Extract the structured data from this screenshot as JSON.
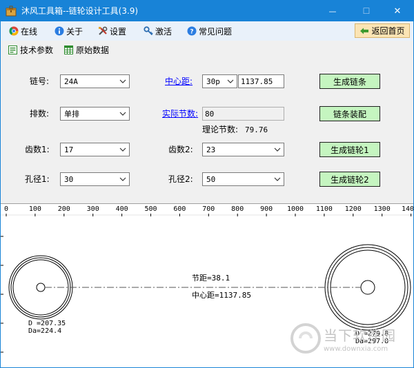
{
  "window": {
    "title": "沐风工具箱--链轮设计工具(3.9)",
    "minimize_glyph": "—",
    "maximize_glyph": "☐",
    "close_glyph": "✕"
  },
  "menu": {
    "items": [
      {
        "label": "在线",
        "icon": "chrome-icon"
      },
      {
        "label": "关于",
        "icon": "info-icon"
      },
      {
        "label": "设置",
        "icon": "tools-icon"
      },
      {
        "label": "激活",
        "icon": "key-icon"
      },
      {
        "label": "常见问题",
        "icon": "help-icon"
      }
    ],
    "back_label": "返回首页"
  },
  "toolbar": {
    "tech_params": "技术参数",
    "raw_data": "原始数据"
  },
  "form": {
    "chain_no_label": "链号:",
    "chain_no_value": "24A",
    "rows_label": "排数:",
    "rows_value": "单排",
    "teeth1_label": "齿数1:",
    "teeth1_value": "17",
    "bore1_label": "孔径1:",
    "bore1_value": "30",
    "center_label": "中心距:",
    "center_unit_value": "30p",
    "center_value": "1137.85",
    "pitches_label": "实际节数:",
    "pitches_value": "80",
    "theory_label": "理论节数:",
    "theory_value": "79.76",
    "teeth2_label": "齿数2:",
    "teeth2_value": "23",
    "bore2_label": "孔径2:",
    "bore2_value": "50",
    "btn_chain": "生成链条",
    "btn_assembly": "链条装配",
    "btn_sprocket1": "生成链轮1",
    "btn_sprocket2": "生成链轮2"
  },
  "drawing": {
    "ruler": [
      "0",
      "100",
      "200",
      "300",
      "400",
      "500",
      "600",
      "700",
      "800",
      "900",
      "1000",
      "1100",
      "1200",
      "1300",
      "140"
    ],
    "pitch_text": "节距=38.1",
    "center_text": "中心距=1137.85",
    "left_d": "D =207.35",
    "left_da": "Da=224.4",
    "right_d": "D =279.8",
    "right_da": "Da=297.8"
  },
  "watermark": {
    "brand": "当下软件园",
    "url": "www.downxia.com"
  },
  "colors": {
    "titlebar": "#1883d7",
    "menubar": "#e9f1fa",
    "green_button": "#c5f5c0",
    "back_button": "#fbe4b4"
  }
}
